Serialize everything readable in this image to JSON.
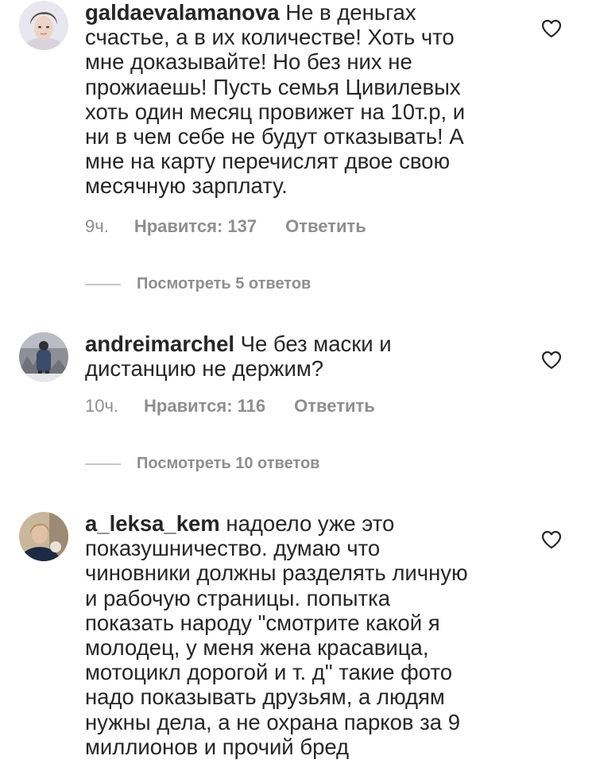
{
  "comments": [
    {
      "username": "galdaevalamanova",
      "text": "Не в деньгах\nсчастье, а в их количестве! Хоть что\nмне доказывайте! Но без них не\nпрожиаешь! Пусть семья Цивилевых\nхоть один месяц провижет на 10т.р, и\nни в чем себе не будут отказывать! А\nмне на карту перечислят двое свою\nмесячную зарплату.",
      "time": "9ч.",
      "likes": "Нравится: 137",
      "reply": "Ответить",
      "view_replies": "Посмотреть 5 ответов"
    },
    {
      "username": "andreimarchel",
      "text": "Че без маски и\nдистанцию не держим?",
      "time": "10ч.",
      "likes": "Нравится: 116",
      "reply": "Ответить",
      "view_replies": "Посмотреть 10 ответов"
    },
    {
      "username": "a_leksa_kem",
      "text": "надоело уже это\nпоказушничество. думаю что\nчиновники должны разделять личную\nи рабочую страницы. попытка\nпоказать народу \"смотрите какой я\nмолодец, у меня жена красавица,\nмотоцикл дорогой и т. д\" такие фото\nнадо показывать друзьям, а людям\nнужны дела, а не охрана парков за 9\nмиллионов и прочий бред"
    }
  ],
  "icons": {
    "like": "heart-outline-icon"
  },
  "colors": {
    "text": "#262626",
    "secondary": "#8e8e8e",
    "divider": "#c7c7c7"
  }
}
